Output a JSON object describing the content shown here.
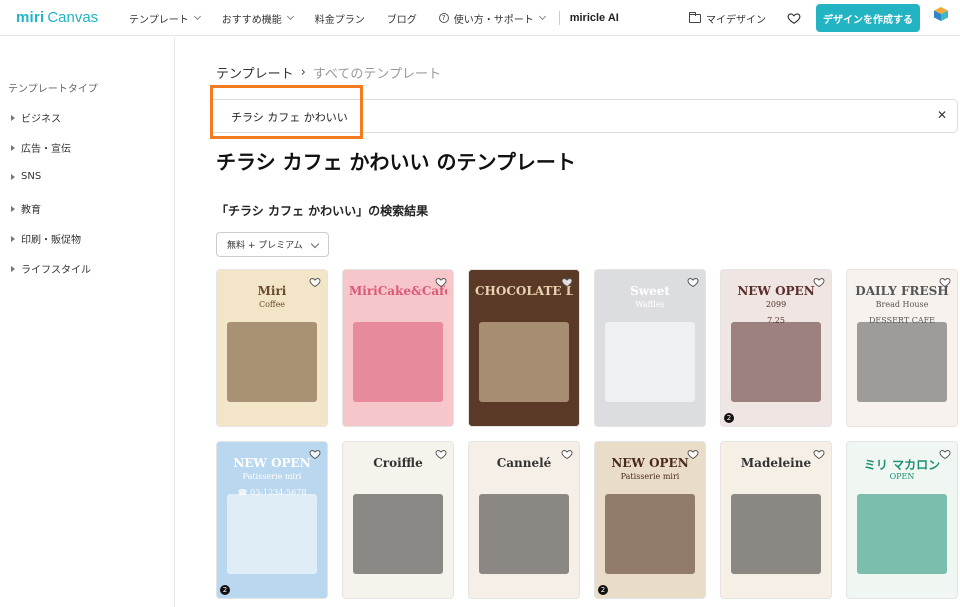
{
  "header": {
    "logo_mark": "miri",
    "logo_text": "Canvas",
    "nav": [
      {
        "label": "テンプレート",
        "dropdown": true
      },
      {
        "label": "おすすめ機能",
        "dropdown": true
      },
      {
        "label": "料金プラン",
        "dropdown": false
      },
      {
        "label": "ブログ",
        "dropdown": false
      },
      {
        "label": "使い方・サポート",
        "dropdown": true,
        "icon": "question-circle-icon"
      }
    ],
    "ai_label": "miricle AI",
    "my_design": "マイデザイン",
    "create_button": "デザインを作成する",
    "brand_color": "#22b4c3"
  },
  "sidebar": {
    "title": "テンプレートタイプ",
    "items": [
      "ビジネス",
      "広告・宣伝",
      "SNS",
      "教育",
      "印刷・販促物",
      "ライフスタイル"
    ]
  },
  "breadcrumb": {
    "root": "テンプレート",
    "separator": "›",
    "current": "すべてのテンプレート"
  },
  "search": {
    "value": "チラシ カフェ かわいい",
    "highlight_color": "#f47b20"
  },
  "page_title": "チラシ カフェ かわいい のテンプレート",
  "results_title": "「チラシ カフェ かわいい」の検索結果",
  "filter": {
    "value": "無料 + プレミアム"
  },
  "templates": [
    {
      "bg": "#f3e6c8",
      "accent": "#6b4a2e",
      "lines": [
        "Miri",
        "Coffee"
      ],
      "badge": ""
    },
    {
      "bg": "#f6c6ca",
      "accent": "#d95a76",
      "lines": [
        "MiriCake&Cafe"
      ],
      "badge": ""
    },
    {
      "bg": "#5a3a26",
      "accent": "#e8d3b0",
      "lines": [
        "CHOCOLATE LATTE"
      ],
      "badge": ""
    },
    {
      "bg": "#dcdde0",
      "accent": "#ffffff",
      "lines": [
        "Sweet",
        "Waffles"
      ],
      "badge": ""
    },
    {
      "bg": "#efe6e4",
      "accent": "#5a2e2a",
      "lines": [
        "NEW OPEN",
        "2099",
        "7.25"
      ],
      "badge": "2"
    },
    {
      "bg": "#f7f2ee",
      "accent": "#555555",
      "lines": [
        "DAILY FRESH",
        "Bread House",
        "DESSERT CAFE"
      ],
      "badge": ""
    },
    {
      "bg": "#b9d7ee",
      "accent": "#ffffff",
      "lines": [
        "NEW OPEN",
        "Patisserie miri",
        "☎ 03-1234-5678"
      ],
      "badge": "2"
    },
    {
      "bg": "#f6f2ec",
      "accent": "#333333",
      "lines": [
        "Croiffle"
      ],
      "badge": ""
    },
    {
      "bg": "#f5efe7",
      "accent": "#333333",
      "lines": [
        "Cannelé"
      ],
      "badge": ""
    },
    {
      "bg": "#e9ddc9",
      "accent": "#4a2a1c",
      "lines": [
        "NEW OPEN",
        "Patisserie miri"
      ],
      "badge": "2"
    },
    {
      "bg": "#f5efe6",
      "accent": "#333333",
      "lines": [
        "Madeleine"
      ],
      "badge": ""
    },
    {
      "bg": "#f0f7f2",
      "accent": "#1c8f74",
      "lines": [
        "ミリ マカロン",
        "OPEN"
      ],
      "badge": ""
    }
  ]
}
